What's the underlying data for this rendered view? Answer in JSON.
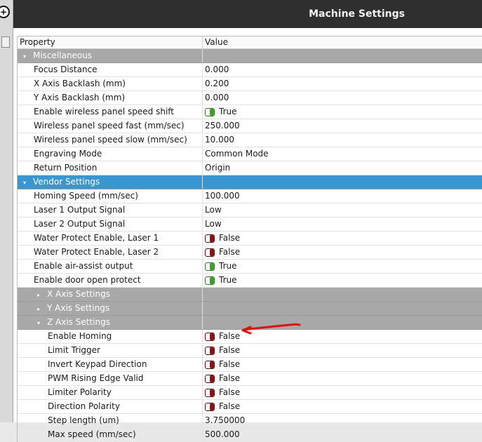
{
  "window": {
    "title": "Machine Settings"
  },
  "left_strip": {
    "button_glyph": "+"
  },
  "table": {
    "headers": [
      "Property",
      "Value"
    ],
    "rows": [
      {
        "type": "cat",
        "label": "Miscellaneous",
        "arrow": "▾",
        "indent": 0
      },
      {
        "type": "prop",
        "label": "Focus Distance",
        "value": "0.000",
        "indent": 1
      },
      {
        "type": "prop",
        "label": "X Axis Backlash (mm)",
        "value": "0.200",
        "indent": 1
      },
      {
        "type": "prop",
        "label": "Y Axis Backlash (mm)",
        "value": "0.000",
        "indent": 1
      },
      {
        "type": "bool",
        "label": "Enable wireless panel speed shift",
        "value": "True",
        "state": true,
        "indent": 1
      },
      {
        "type": "prop",
        "label": "Wireless panel speed fast (mm/sec)",
        "value": "250.000",
        "indent": 1
      },
      {
        "type": "prop",
        "label": "Wireless panel speed slow (mm/sec)",
        "value": "10.000",
        "indent": 1
      },
      {
        "type": "prop",
        "label": "Engraving Mode",
        "value": "Common Mode",
        "indent": 1
      },
      {
        "type": "prop",
        "label": "Return Position",
        "value": "Origin",
        "indent": 1
      },
      {
        "type": "cat",
        "label": "Vendor Settings",
        "arrow": "▾",
        "indent": 0,
        "selected": true
      },
      {
        "type": "prop",
        "label": "Homing Speed (mm/sec)",
        "value": "100.000",
        "indent": 1
      },
      {
        "type": "prop",
        "label": "Laser 1 Output Signal",
        "value": "Low",
        "indent": 1
      },
      {
        "type": "prop",
        "label": "Laser 2 Output Signal",
        "value": "Low",
        "indent": 1
      },
      {
        "type": "bool",
        "label": "Water Protect Enable, Laser 1",
        "value": "False",
        "state": false,
        "indent": 1
      },
      {
        "type": "bool",
        "label": "Water Protect Enable, Laser 2",
        "value": "False",
        "state": false,
        "indent": 1
      },
      {
        "type": "bool",
        "label": "Enable air-assist output",
        "value": "True",
        "state": true,
        "indent": 1
      },
      {
        "type": "bool",
        "label": "Enable door open protect",
        "value": "True",
        "state": true,
        "indent": 1
      },
      {
        "type": "cat",
        "label": "X Axis Settings",
        "arrow": "▸",
        "indent": 1
      },
      {
        "type": "cat",
        "label": "Y Axis Settings",
        "arrow": "▸",
        "indent": 1
      },
      {
        "type": "cat",
        "label": "Z Axis Settings",
        "arrow": "▾",
        "indent": 1
      },
      {
        "type": "bool",
        "label": "Enable Homing",
        "value": "False",
        "state": false,
        "indent": 2
      },
      {
        "type": "bool",
        "label": "Limit Trigger",
        "value": "False",
        "state": false,
        "indent": 2
      },
      {
        "type": "bool",
        "label": "Invert Keypad Direction",
        "value": "False",
        "state": false,
        "indent": 2
      },
      {
        "type": "bool",
        "label": "PWM Rising Edge Valid",
        "value": "False",
        "state": false,
        "indent": 2
      },
      {
        "type": "bool",
        "label": "Limiter Polarity",
        "value": "False",
        "state": false,
        "indent": 2
      },
      {
        "type": "bool",
        "label": "Direction Polarity",
        "value": "False",
        "state": false,
        "indent": 2
      },
      {
        "type": "prop",
        "label": "Step length (um)",
        "value": "3.750000",
        "indent": 2
      },
      {
        "type": "prop",
        "label": "Max speed (mm/sec)",
        "value": "500.000",
        "indent": 2
      }
    ]
  },
  "colors": {
    "category_bg": "#a8a8a8",
    "selected_bg": "#3a96d0",
    "toggle_on": "#3ea12a",
    "toggle_off": "#8a1414",
    "annotation": "#e01010"
  }
}
